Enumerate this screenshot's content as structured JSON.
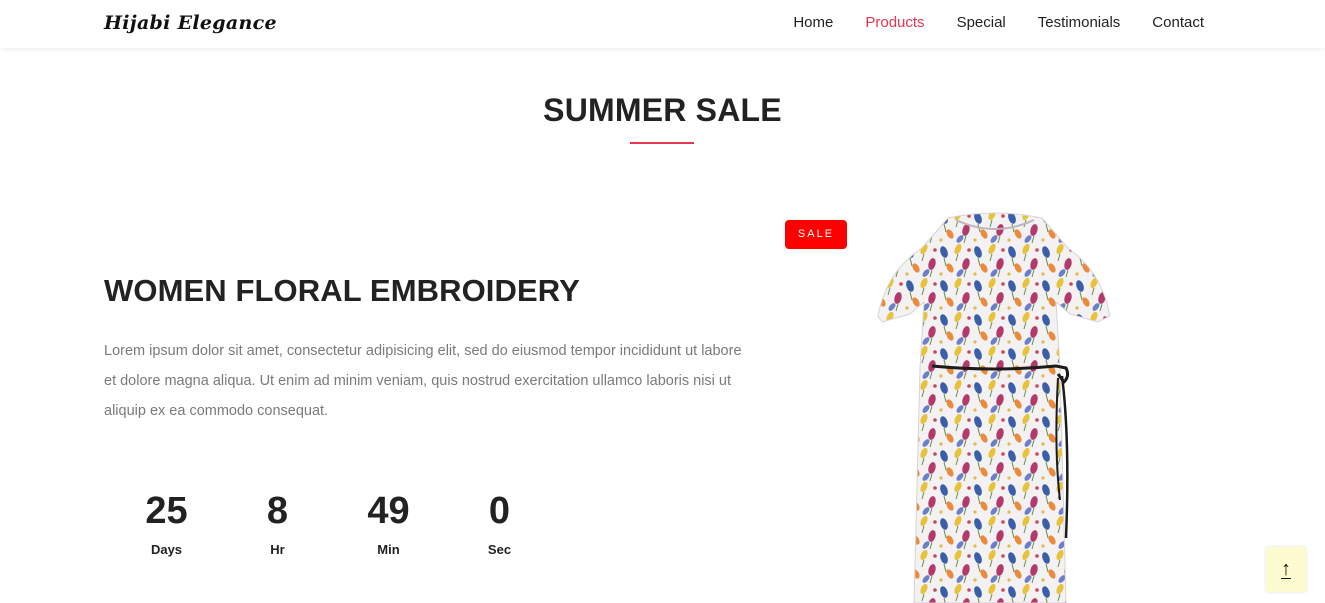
{
  "header": {
    "logo": "Hijabi Elegance",
    "nav": [
      "Home",
      "Products",
      "Special",
      "Testimonials",
      "Contact"
    ],
    "active_nav": "Products"
  },
  "section": {
    "title": "SUMMER SALE"
  },
  "product": {
    "title": "WOMEN FLORAL EMBROIDERY",
    "description": "Lorem ipsum dolor sit amet, consectetur adipisicing elit, sed do eiusmod tempor incididunt ut labore et dolore magna aliqua. Ut enim ad minim veniam, quis nostrud exercitation ullamco laboris nisi ut aliquip ex ea commodo consequat.",
    "badge": "SALE"
  },
  "countdown": {
    "days": {
      "value": "25",
      "label": "Days"
    },
    "hours": {
      "value": "8",
      "label": "Hr"
    },
    "minutes": {
      "value": "49",
      "label": "Min"
    },
    "seconds": {
      "value": "0",
      "label": "Sec"
    }
  },
  "back_to_top": {
    "icon": "arrow-up-icon",
    "glyph": "↑"
  },
  "colors": {
    "accent": "#e8364f",
    "badge": "#ff0000",
    "back_to_top_bg": "#fdfbd0"
  }
}
